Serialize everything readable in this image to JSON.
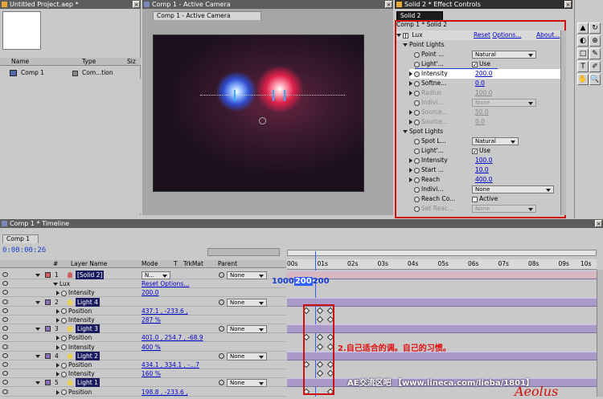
{
  "project_panel": {
    "title": "Untitled Project.aep *",
    "col_name": "Name",
    "col_type": "Type",
    "col_size": "Siz",
    "item_name": "Comp 1",
    "item_type": "Com...tion"
  },
  "comp_panel": {
    "title": "Comp 1 - Active Camera",
    "tab": "Comp 1 - Active Camera"
  },
  "effect_panel": {
    "title": "Solid 2 * Effect Controls",
    "tab": "Solid 2",
    "breadcrumb": "Comp 1 * Solid 2",
    "fx_name": "Lux",
    "reset": "Reset",
    "options": "Options...",
    "about": "About...",
    "sections": [
      {
        "label": "Point Lights",
        "rows": [
          {
            "label": "Point ...",
            "type": "dropdown",
            "value": "Natural"
          },
          {
            "label": "Light'...",
            "type": "checkbox",
            "value": "Use",
            "checked": true
          },
          {
            "label": "Intensity",
            "type": "value",
            "value": "200.0",
            "highlight": true
          },
          {
            "label": "Softne...",
            "type": "value",
            "value": "0.0"
          },
          {
            "label": "Radius",
            "type": "value",
            "value": "100.0",
            "disabled": true
          },
          {
            "label": "Indivi...",
            "type": "dropdown",
            "value": "None",
            "disabled": true
          },
          {
            "label": "Source...",
            "type": "value",
            "value": "50.0",
            "disabled": true
          },
          {
            "label": "Source...",
            "type": "value",
            "value": "0.0",
            "disabled": true
          }
        ]
      },
      {
        "label": "Spot Lights",
        "rows": [
          {
            "label": "Spot L...",
            "type": "dropdown",
            "value": "Natural"
          },
          {
            "label": "Light'...",
            "type": "checkbox",
            "value": "Use",
            "checked": true
          },
          {
            "label": "Intensity",
            "type": "value",
            "value": "100.0"
          },
          {
            "label": "Start ...",
            "type": "value",
            "value": "10.0"
          },
          {
            "label": "Reach",
            "type": "value",
            "value": "400.0"
          },
          {
            "label": "Indivi...",
            "type": "dropdown",
            "value": "None"
          },
          {
            "label": "Reach Co...",
            "type": "checkbox",
            "value": "Active",
            "checked": false
          },
          {
            "label": "Set Reac...",
            "type": "dropdown",
            "value": "None",
            "disabled": true
          }
        ]
      }
    ]
  },
  "timeline": {
    "title": "Comp 1 * Timeline",
    "tab": "Comp 1",
    "timecode": "0:00:00:26",
    "headers": {
      "num": "#",
      "layer_name": "Layer Name",
      "mode": "Mode",
      "t": "T",
      "trkmat": "TrkMat",
      "parent": "Parent"
    },
    "ruler": [
      "00s",
      "01s",
      "02s",
      "03s",
      "04s",
      "05s",
      "06s",
      "07s",
      "08s",
      "09s",
      "10s"
    ],
    "value_tooltip": {
      "a": "1000",
      "b": "200",
      "c": "200"
    },
    "rows": [
      {
        "kind": "layer",
        "num": "1",
        "name": "[Solid 2]",
        "mode": "N...",
        "parent": "None",
        "color": "#d06060"
      },
      {
        "kind": "fx",
        "name": "Lux",
        "value": "Reset Options..."
      },
      {
        "kind": "prop",
        "name": "Intensity",
        "value": "200.0"
      },
      {
        "kind": "layer",
        "num": "2",
        "name": "Light 4",
        "parent": "None",
        "color": "#e8d050"
      },
      {
        "kind": "prop",
        "name": "Position",
        "value": "437.1 , -233.6 ,"
      },
      {
        "kind": "prop",
        "name": "Intensity",
        "value": "287 %"
      },
      {
        "kind": "layer",
        "num": "3",
        "name": "Light 3",
        "parent": "None",
        "color": "#e8d050"
      },
      {
        "kind": "prop",
        "name": "Position",
        "value": "401.0 , 254.7 , -68.9"
      },
      {
        "kind": "prop",
        "name": "Intensity",
        "value": "400 %"
      },
      {
        "kind": "layer",
        "num": "4",
        "name": "Light 2",
        "parent": "None",
        "color": "#e8d050"
      },
      {
        "kind": "prop",
        "name": "Position",
        "value": "434.1 , 334.1 , -...7"
      },
      {
        "kind": "prop",
        "name": "Intensity",
        "value": "160 %"
      },
      {
        "kind": "layer",
        "num": "5",
        "name": "Light 1",
        "parent": "None",
        "color": "#e8d050"
      },
      {
        "kind": "prop",
        "name": "Position",
        "value": "198.8 , -233.6 ,"
      }
    ]
  },
  "annotation": {
    "text": "2.自己适合的调。自己的习惯。",
    "color": "#e01010"
  },
  "watermark": {
    "text": "AE交流区吧 【www.lineca.com/lieba/1801】",
    "signature": "Aeolus"
  }
}
